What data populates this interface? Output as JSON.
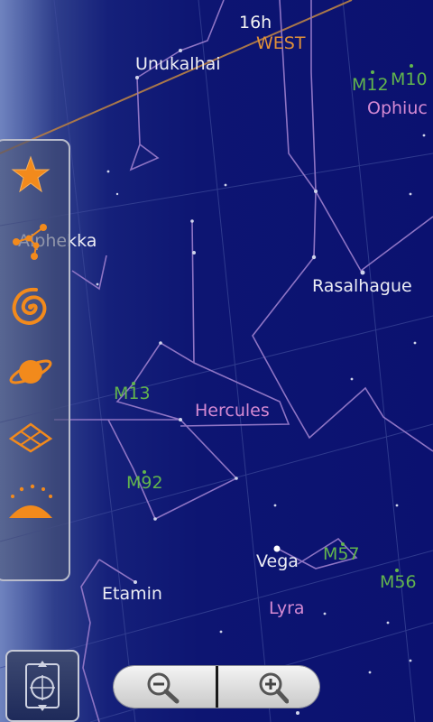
{
  "sky": {
    "time_marker": "16h",
    "direction": "WEST",
    "stars": [
      "Unukalhai",
      "Alphekka",
      "Rasalhague",
      "Vega",
      "Etamin"
    ],
    "constellations": [
      "Ophiuc",
      "Hercules",
      "Lyra"
    ],
    "messier": [
      "M12",
      "M10",
      "M13",
      "M92",
      "M57",
      "M56"
    ]
  },
  "toolbar": {
    "items": [
      {
        "icon": "star-icon"
      },
      {
        "icon": "constellation-icon"
      },
      {
        "icon": "galaxy-icon"
      },
      {
        "icon": "planet-icon"
      },
      {
        "icon": "grid-icon"
      },
      {
        "icon": "horizon-icon"
      }
    ]
  },
  "controls": {
    "compass_icon": "compass-icon",
    "zoom_out_icon": "zoom-out-icon",
    "zoom_in_icon": "zoom-in-icon"
  },
  "colors": {
    "sky": "#0b1170",
    "constellation_line": "#8e74c4",
    "constellation_label": "#d58ad3",
    "messier_label": "#62b54d",
    "direction_label": "#e0913a",
    "toolbar_icon": "#f28a1c"
  }
}
